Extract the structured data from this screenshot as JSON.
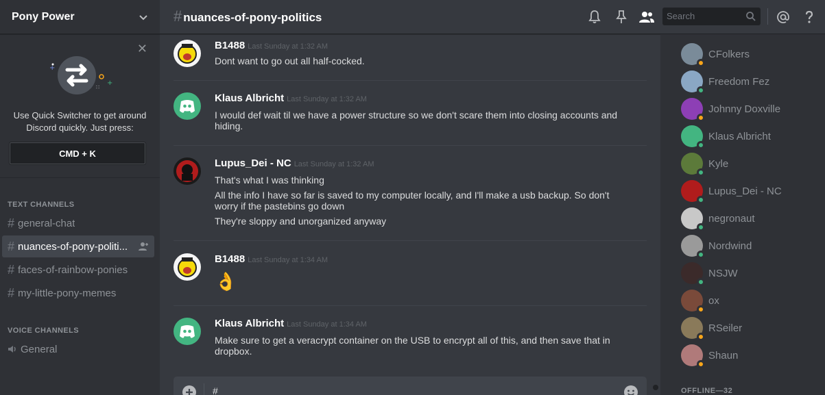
{
  "guild": {
    "name": "Pony Power"
  },
  "quick_switcher": {
    "text": "Use Quick Switcher to get around Discord quickly. Just press:",
    "shortcut": "CMD + K"
  },
  "sidebar": {
    "text_category": "TEXT CHANNELS",
    "voice_category": "VOICE CHANNELS",
    "text_channels": [
      {
        "label": "general-chat",
        "active": false
      },
      {
        "label": "nuances-of-pony-politi...",
        "active": true
      },
      {
        "label": "faces-of-rainbow-ponies",
        "active": false
      },
      {
        "label": "my-little-pony-memes",
        "active": false
      }
    ],
    "voice_channels": [
      {
        "label": "General"
      }
    ]
  },
  "header": {
    "channel_name": "nuances-of-pony-politics",
    "search_placeholder": "Search"
  },
  "messages": [
    {
      "author": "B1488",
      "time": "Last Sunday at 1:32 AM",
      "avatar": "b1488",
      "lines": [
        "Dont want to go out all half-cocked."
      ]
    },
    {
      "author": "Klaus Albricht",
      "time": "Last Sunday at 1:32 AM",
      "avatar": "discord",
      "lines": [
        "I would def wait til we have a power structure so we don't scare them into closing accounts and hiding."
      ]
    },
    {
      "author": "Lupus_Dei - NC",
      "time": "Last Sunday at 1:32 AM",
      "avatar": "lupus",
      "lines": [
        "That's what I was thinking",
        "All the info I have so far is saved to my computer locally, and I'll make a usb backup. So don't worry if the pastebins go down",
        "They're sloppy and unorganized anyway"
      ]
    },
    {
      "author": "B1488",
      "time": "Last Sunday at 1:34 AM",
      "avatar": "b1488",
      "lines": [
        "👌"
      ]
    },
    {
      "author": "Klaus Albricht",
      "time": "Last Sunday at 1:34 AM",
      "avatar": "discord",
      "lines": [
        "Make sure to get a veracrypt container on the USB to encrypt all of this, and then save that in dropbox."
      ]
    }
  ],
  "composer": {
    "text": "#"
  },
  "members": [
    {
      "name": "CFolkers",
      "status": "idle",
      "color": "#7a8b99"
    },
    {
      "name": "Freedom Fez",
      "status": "online",
      "color": "#8aa7c4"
    },
    {
      "name": "Johnny Doxville",
      "status": "idle",
      "color": "#8d3fb5"
    },
    {
      "name": "Klaus Albricht",
      "status": "online",
      "color": "#43b581"
    },
    {
      "name": "Kyle",
      "status": "online",
      "color": "#5c7a3a"
    },
    {
      "name": "Lupus_Dei - NC",
      "status": "online",
      "color": "#b01c1c"
    },
    {
      "name": "negronaut",
      "status": "online",
      "color": "#c8c8c8"
    },
    {
      "name": "Nordwind",
      "status": "online",
      "color": "#9a9a9a"
    },
    {
      "name": "NSJW",
      "status": "online",
      "color": "#3b2a2a"
    },
    {
      "name": "ox",
      "status": "idle",
      "color": "#7a4a3a"
    },
    {
      "name": "RSeiler",
      "status": "idle",
      "color": "#8a7a5a"
    },
    {
      "name": "Shaun",
      "status": "idle",
      "color": "#b07a7a"
    }
  ],
  "offline_label": "OFFLINE—32",
  "status_colors": {
    "online": "#43b581",
    "idle": "#faa61a"
  }
}
